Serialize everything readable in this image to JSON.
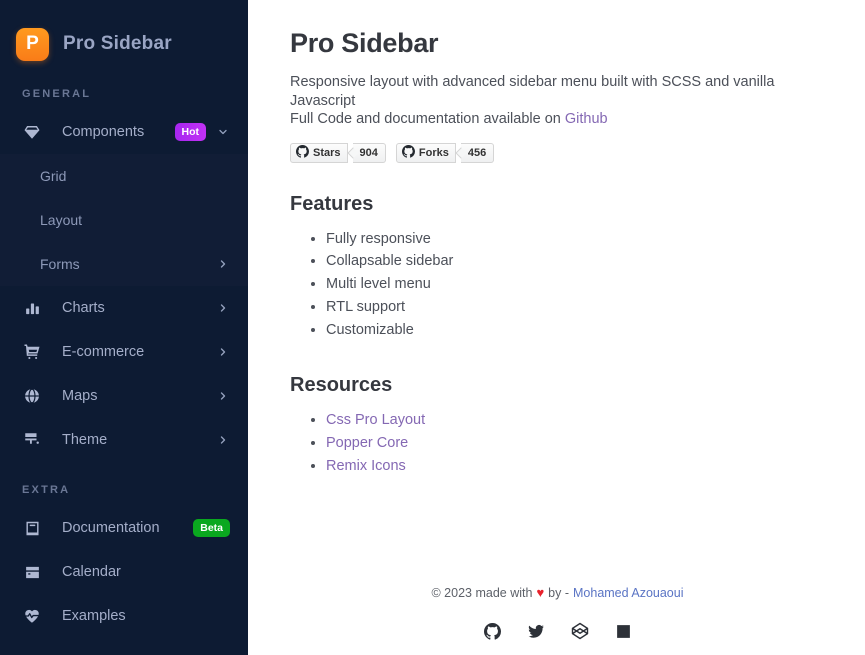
{
  "sidebar": {
    "logo_letter": "P",
    "brand": "Pro Sidebar",
    "sections": [
      {
        "title": "GENERAL",
        "items": [
          {
            "label": "Components",
            "icon": "gem-icon",
            "badge": "Hot",
            "badge_type": "hot",
            "chevron": "down",
            "expanded": true
          },
          {
            "label": "Grid",
            "icon": "none",
            "sub": true
          },
          {
            "label": "Layout",
            "icon": "none",
            "sub": true
          },
          {
            "label": "Forms",
            "icon": "none",
            "sub": true,
            "chevron": "right"
          },
          {
            "label": "Charts",
            "icon": "bar-chart-icon",
            "chevron": "right"
          },
          {
            "label": "E-commerce",
            "icon": "shopping-cart-icon",
            "chevron": "right"
          },
          {
            "label": "Maps",
            "icon": "globe-icon",
            "chevron": "right"
          },
          {
            "label": "Theme",
            "icon": "paint-brush-icon",
            "chevron": "right"
          }
        ]
      },
      {
        "title": "EXTRA",
        "items": [
          {
            "label": "Documentation",
            "icon": "book-icon",
            "badge": "Beta",
            "badge_type": "beta"
          },
          {
            "label": "Calendar",
            "icon": "calendar-icon"
          },
          {
            "label": "Examples",
            "icon": "heart-pulse-icon"
          }
        ]
      }
    ]
  },
  "main": {
    "title": "Pro Sidebar",
    "description_line1": "Responsive layout with advanced sidebar menu built with SCSS and vanilla",
    "description_line2": "Javascript",
    "description_line3_prefix": "Full Code and documentation available on ",
    "description_link": "Github",
    "badges": [
      {
        "icon": "github-icon",
        "label": "Stars",
        "count": "904"
      },
      {
        "icon": "github-icon",
        "label": "Forks",
        "count": "456"
      }
    ],
    "features_title": "Features",
    "features": [
      "Fully responsive",
      "Collapsable sidebar",
      "Multi level menu",
      "RTL support",
      "Customizable"
    ],
    "resources_title": "Resources",
    "resources": [
      "Css Pro Layout",
      "Popper Core",
      "Remix Icons"
    ]
  },
  "footer": {
    "copyright": "© 2023 made with",
    "heart": "♥",
    "by": "by -",
    "author": "Mohamed Azouaoui",
    "socials": [
      {
        "name": "github-icon"
      },
      {
        "name": "twitter-icon"
      },
      {
        "name": "codepen-icon"
      },
      {
        "name": "linkedin-icon"
      }
    ]
  },
  "colors": {
    "sidebar_bg": "#0d1b33",
    "submenu_bg": "#111d36",
    "brand_orange": "#f97c18",
    "badge_hot": "#b02ef2",
    "badge_beta": "#0aa81f",
    "link_purple": "#8468b3",
    "heart_red": "#e8222c",
    "author_blue": "#5a74c4"
  }
}
